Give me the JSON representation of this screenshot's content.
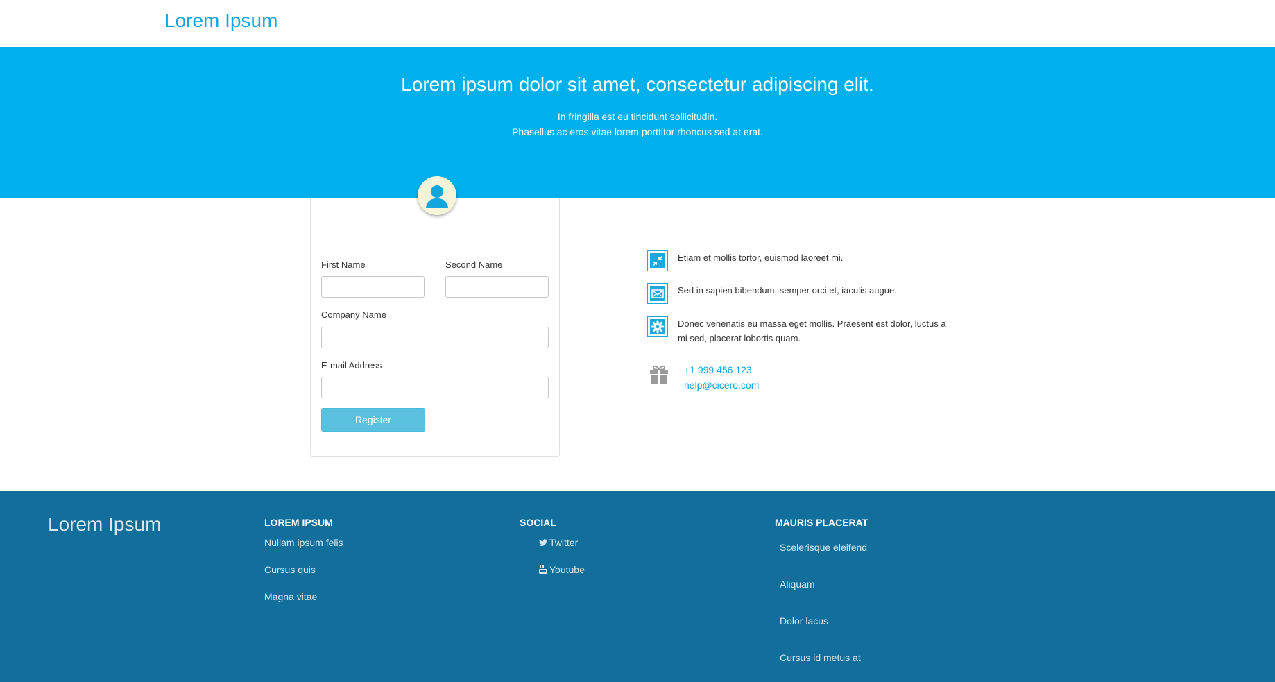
{
  "header": {
    "brand": "Lorem Ipsum"
  },
  "hero": {
    "title": "Lorem ipsum dolor sit amet, consectetur adipiscing elit.",
    "subtitle_line1": "In fringilla est eu tincidunt sollicitudin.",
    "subtitle_line2": "Phasellus ac eros vitae lorem porttitor rhoncus sed at erat."
  },
  "form": {
    "first_name_label": "First Name",
    "first_name_value": "",
    "second_name_label": "Second Name",
    "second_name_value": "",
    "company_label": "Company Name",
    "company_value": "",
    "email_label": "E-mail Address",
    "email_value": "",
    "register_label": "Register"
  },
  "features": [
    {
      "icon": "compress-arrows-icon",
      "text": "Etiam et mollis tortor, euismod laoreet mi."
    },
    {
      "icon": "envelope-icon",
      "text": "Sed in sapien bibendum, semper orci et, iaculis augue."
    },
    {
      "icon": "gear-icon",
      "text": "Donec venenatis eu massa eget mollis. Praesent est dolor, luctus a mi sed, placerat lobortis quam."
    }
  ],
  "contact": {
    "icon": "gift-icon",
    "phone": "+1 999 456 123",
    "email": "help@cicero.com"
  },
  "footer": {
    "brand": "Lorem Ipsum",
    "col1": {
      "heading": "LOREM IPSUM",
      "links": [
        "Nullam ipsum felis",
        "Cursus quis",
        "Magna vitae"
      ]
    },
    "social": {
      "heading": "SOCIAL",
      "links": [
        {
          "icon": "twitter-icon",
          "label": "Twitter"
        },
        {
          "icon": "youtube-icon",
          "label": "Youtube"
        }
      ]
    },
    "col3": {
      "heading": "MAURIS PLACERAT",
      "links": [
        "Scelerisque eleifend",
        "Aliquam",
        "Dolor lacus",
        "Cursus id metus at"
      ]
    }
  },
  "colors": {
    "accent": "#11a7de",
    "hero_bg": "#00b0ec",
    "footer_bg": "#126f9c",
    "button_bg": "#5bc0de"
  }
}
